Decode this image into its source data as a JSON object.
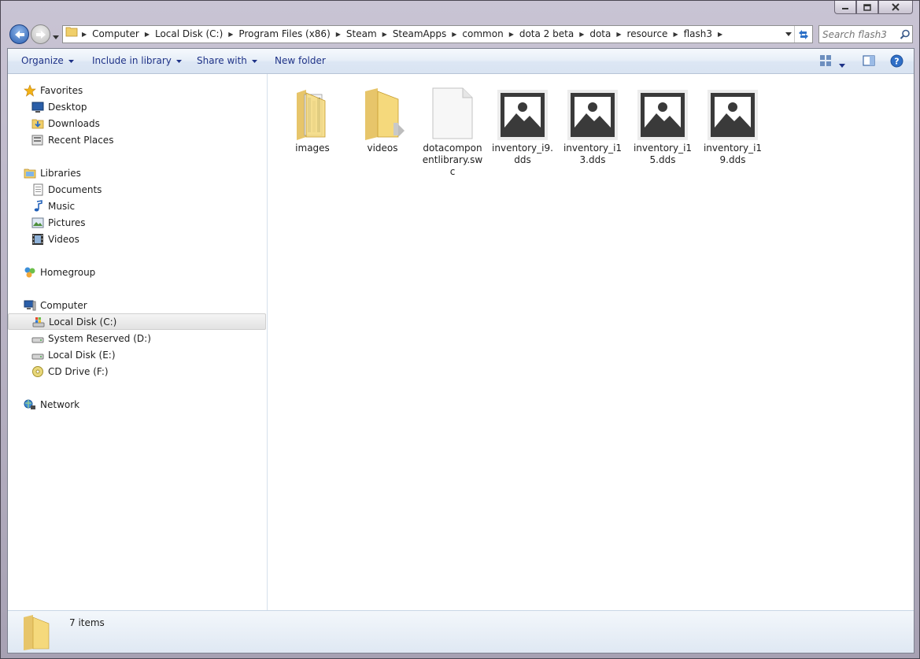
{
  "window": {
    "caption_buttons": [
      "minimize-icon",
      "maximize-icon",
      "close-icon"
    ]
  },
  "address": {
    "crumbs": [
      "Computer",
      "Local Disk (C:)",
      "Program Files (x86)",
      "Steam",
      "SteamApps",
      "common",
      "dota 2 beta",
      "dota",
      "resource",
      "flash3"
    ]
  },
  "search": {
    "placeholder": "Search flash3"
  },
  "toolbar": {
    "organize": "Organize",
    "include_in_library": "Include in library",
    "share_with": "Share with",
    "new_folder": "New folder"
  },
  "nav": {
    "favorites": "Favorites",
    "desktop": "Desktop",
    "downloads": "Downloads",
    "recent_places": "Recent Places",
    "libraries": "Libraries",
    "documents": "Documents",
    "music": "Music",
    "pictures": "Pictures",
    "videos": "Videos",
    "homegroup": "Homegroup",
    "computer": "Computer",
    "local_disk_c": "Local Disk (C:)",
    "system_reserved_d": "System Reserved (D:)",
    "local_disk_e": "Local Disk (E:)",
    "cd_drive_f": "CD Drive (F:)",
    "network": "Network"
  },
  "files": [
    {
      "label": "images",
      "kind": "folder"
    },
    {
      "label": "videos",
      "kind": "folder"
    },
    {
      "label": "dotacomponentlibrary.swc",
      "kind": "document"
    },
    {
      "label": "inventory_i9.dds",
      "kind": "image"
    },
    {
      "label": "inventory_i13.dds",
      "kind": "image"
    },
    {
      "label": "inventory_i15.dds",
      "kind": "image"
    },
    {
      "label": "inventory_i19.dds",
      "kind": "image"
    }
  ],
  "status": {
    "count": "7 items"
  },
  "colors": {
    "accent": "#1e3287",
    "selection": "#e2e2e2",
    "folder": "#f5d97c"
  }
}
